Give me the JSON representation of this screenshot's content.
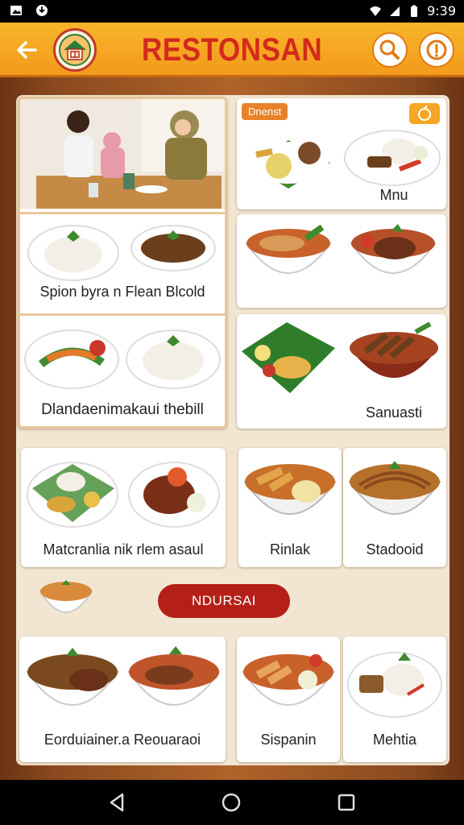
{
  "status_bar": {
    "time": "9:39"
  },
  "app": {
    "title": "RESTONSAN"
  },
  "top_left_card": {
    "photo_desc_label": "",
    "row1_label": "Spion byra n Flean Blcold",
    "row2_label": "Dlandaenimakaui thebill"
  },
  "top_right_card": {
    "badge": "Dnenst",
    "row1_label": "Mnu",
    "row2_label": "",
    "row3_label": "Sanuasti"
  },
  "mid_cards": [
    {
      "label": "Matcranlia nik rlem asaul"
    },
    {
      "label": "Rinlak"
    },
    {
      "label": "Stadooid"
    }
  ],
  "section": {
    "label": "NDURSAI"
  },
  "bottom_cards": [
    {
      "label": "Eorduiainer.a Reouaraoi"
    },
    {
      "label": "Sispanin"
    },
    {
      "label": "Mehtia"
    }
  ],
  "icons": {
    "back": "arrow-left-icon",
    "logo": "house-logo-icon",
    "search": "search-icon",
    "info": "info-icon"
  },
  "colors": {
    "app_bar": "#f39a1c",
    "title": "#d42a1c",
    "pill": "#b42018",
    "panel": "#f2e6d2"
  }
}
